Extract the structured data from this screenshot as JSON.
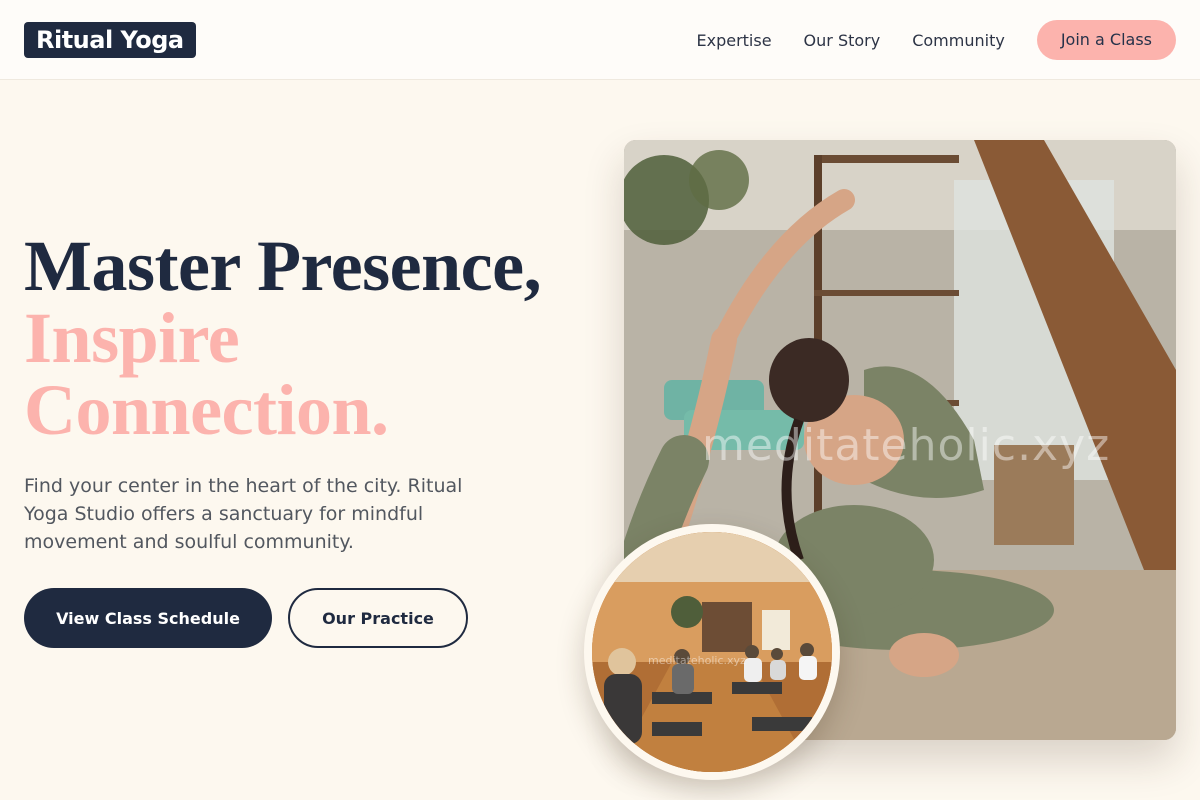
{
  "header": {
    "logo": "Ritual Yoga",
    "nav": [
      "Expertise",
      "Our Story",
      "Community"
    ],
    "cta": "Join a Class"
  },
  "hero": {
    "headline_line1": "Master Presence,",
    "headline_line2": "Inspire",
    "headline_line3": "Connection.",
    "subtext": "Find your center in the heart of the city. Ritual Yoga Studio offers a sanctuary for mindful movement and soulful community.",
    "primary_button": "View Class Schedule",
    "secondary_button": "Our Practice"
  },
  "images": {
    "main_watermark": "meditateholic.xyz",
    "circle_watermark": "meditateholic.xyz"
  },
  "colors": {
    "navy": "#1f2a40",
    "pink": "#fcb3ad",
    "cream": "#fdf8ef"
  }
}
